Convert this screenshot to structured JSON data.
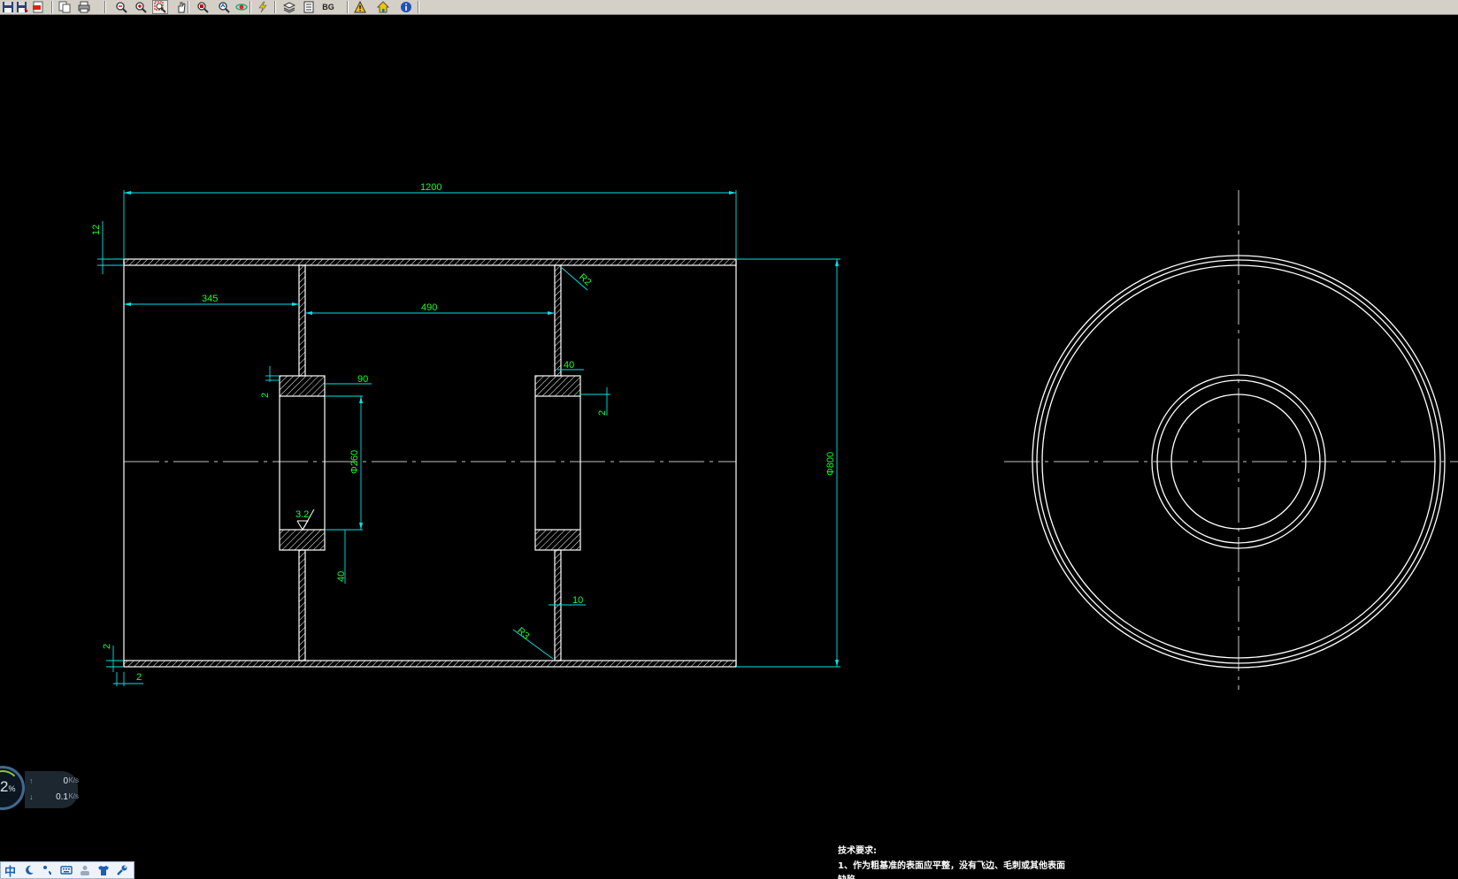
{
  "toolbar": {
    "buttons": [
      {
        "name": "save-icon",
        "tooltip": ""
      },
      {
        "name": "save-as-icon",
        "tooltip": ""
      },
      {
        "name": "export-pdf-icon",
        "tooltip": ""
      },
      {
        "name": "copy-icon",
        "tooltip": ""
      },
      {
        "name": "print-icon",
        "tooltip": ""
      },
      {
        "name": "zoom-out-icon",
        "tooltip": ""
      },
      {
        "name": "zoom-in-icon",
        "tooltip": ""
      },
      {
        "name": "zoom-window-icon",
        "tooltip": "",
        "active": true
      },
      {
        "name": "pan-icon",
        "tooltip": ""
      },
      {
        "name": "zoom-extents-icon",
        "tooltip": ""
      },
      {
        "name": "zoom-realtime-icon",
        "tooltip": ""
      },
      {
        "name": "3d-orbit-icon",
        "tooltip": ""
      },
      {
        "name": "lightning-icon",
        "tooltip": ""
      },
      {
        "name": "layers-icon",
        "tooltip": ""
      },
      {
        "name": "layout-icon",
        "tooltip": ""
      },
      {
        "name": "bg-color-icon",
        "label": "BG"
      },
      {
        "name": "warning-icon",
        "tooltip": ""
      },
      {
        "name": "home-icon",
        "tooltip": ""
      },
      {
        "name": "info-icon",
        "tooltip": ""
      }
    ]
  },
  "colors": {
    "background": "#000000",
    "geometry": "#ffffff",
    "dimension_lines": "#00e5e5",
    "dimension_text": "#19ff2a",
    "toolbar": "#d4d0c8"
  },
  "drawing": {
    "dimensions": {
      "overall_length": "1200",
      "shell_thickness": "12",
      "disc_offset": "345",
      "disc_spacing": "490",
      "fillet_top": "R2",
      "fillet_bottom": "R3",
      "hub_width": "90",
      "hub_width_right": "40",
      "hub_chamfer_left": "2",
      "hub_chamfer_right": "2",
      "bore_diameter": "Φ260",
      "hub_thickness": "40",
      "web_thickness": "10",
      "outer_diameter": "Φ800",
      "bottom_small": "2",
      "bottom_offset": "2",
      "surface_finish": "3.2"
    },
    "notes": {
      "heading": "技术要求:",
      "line1": "1、作为粗基准的表面应平整，没有飞边、毛刺或其他表面",
      "line2": "缺陷"
    }
  },
  "net_monitor": {
    "percent": "2",
    "percent_unit": "%",
    "upload": "0",
    "upload_unit": "K/s",
    "download": "0.1",
    "download_unit": "K/s"
  },
  "ime_bar": {
    "language": "中"
  }
}
